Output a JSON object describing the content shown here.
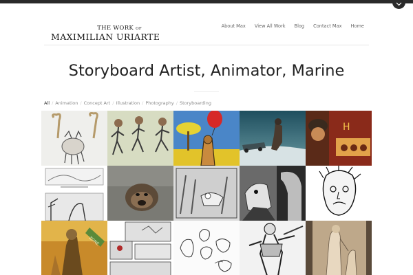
{
  "site": {
    "logo_line1": "THE WORK",
    "logo_of": "OF",
    "logo_name": "MAXIMILIAN URIARTE"
  },
  "nav": {
    "items": [
      {
        "label": "About Max"
      },
      {
        "label": "View All Work"
      },
      {
        "label": "Blog"
      },
      {
        "label": "Contact Max"
      },
      {
        "label": "Home"
      }
    ]
  },
  "headline": "Storyboard Artist, Animator, Marine",
  "filters": [
    {
      "label": "All",
      "active": true
    },
    {
      "label": "Animation"
    },
    {
      "label": "Concept Art"
    },
    {
      "label": "Illustration"
    },
    {
      "label": "Photography"
    },
    {
      "label": "Storyboarding"
    }
  ],
  "colors": {
    "topbar": "#2a2a2a",
    "text": "#222222",
    "muted": "#8a8a8a"
  },
  "icons": {
    "dropdown": "chevron-down-icon"
  }
}
